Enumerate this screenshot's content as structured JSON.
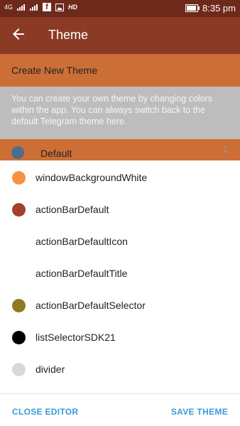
{
  "status_bar": {
    "network": "4G",
    "hd": "HD",
    "facebook_glyph": "f",
    "battery_level": 0.9,
    "time": "8:35 pm"
  },
  "app_bar": {
    "title": "Theme",
    "back_icon": "arrow-back-icon"
  },
  "create_row": {
    "label": "Create New Theme"
  },
  "info": {
    "text": "You can create your own theme by changing colors within the app. You can always switch back to the default Telegram theme here."
  },
  "default_row": {
    "label": "Default",
    "swatch_color": "#4b6d8e"
  },
  "editor": {
    "items": [
      {
        "name": "windowBackgroundWhite",
        "color": "#f39444"
      },
      {
        "name": "actionBarDefault",
        "color": "#a43f2b"
      },
      {
        "name": "actionBarDefaultIcon",
        "color": "#ffffff"
      },
      {
        "name": "actionBarDefaultTitle",
        "color": "#ffffff"
      },
      {
        "name": "actionBarDefaultSelector",
        "color": "#8f7a22"
      },
      {
        "name": "listSelectorSDK21",
        "color": "#000000"
      },
      {
        "name": "divider",
        "color": "#d9d9d9"
      }
    ],
    "close_label": "CLOSE EDITOR",
    "save_label": "SAVE THEME"
  },
  "colors": {
    "status_bar": "#6d2a1b",
    "app_bar": "#8b3a26",
    "accent_row": "#cc6f37",
    "info_bg": "#bdbdbd",
    "link_blue": "#3a9bd8"
  }
}
